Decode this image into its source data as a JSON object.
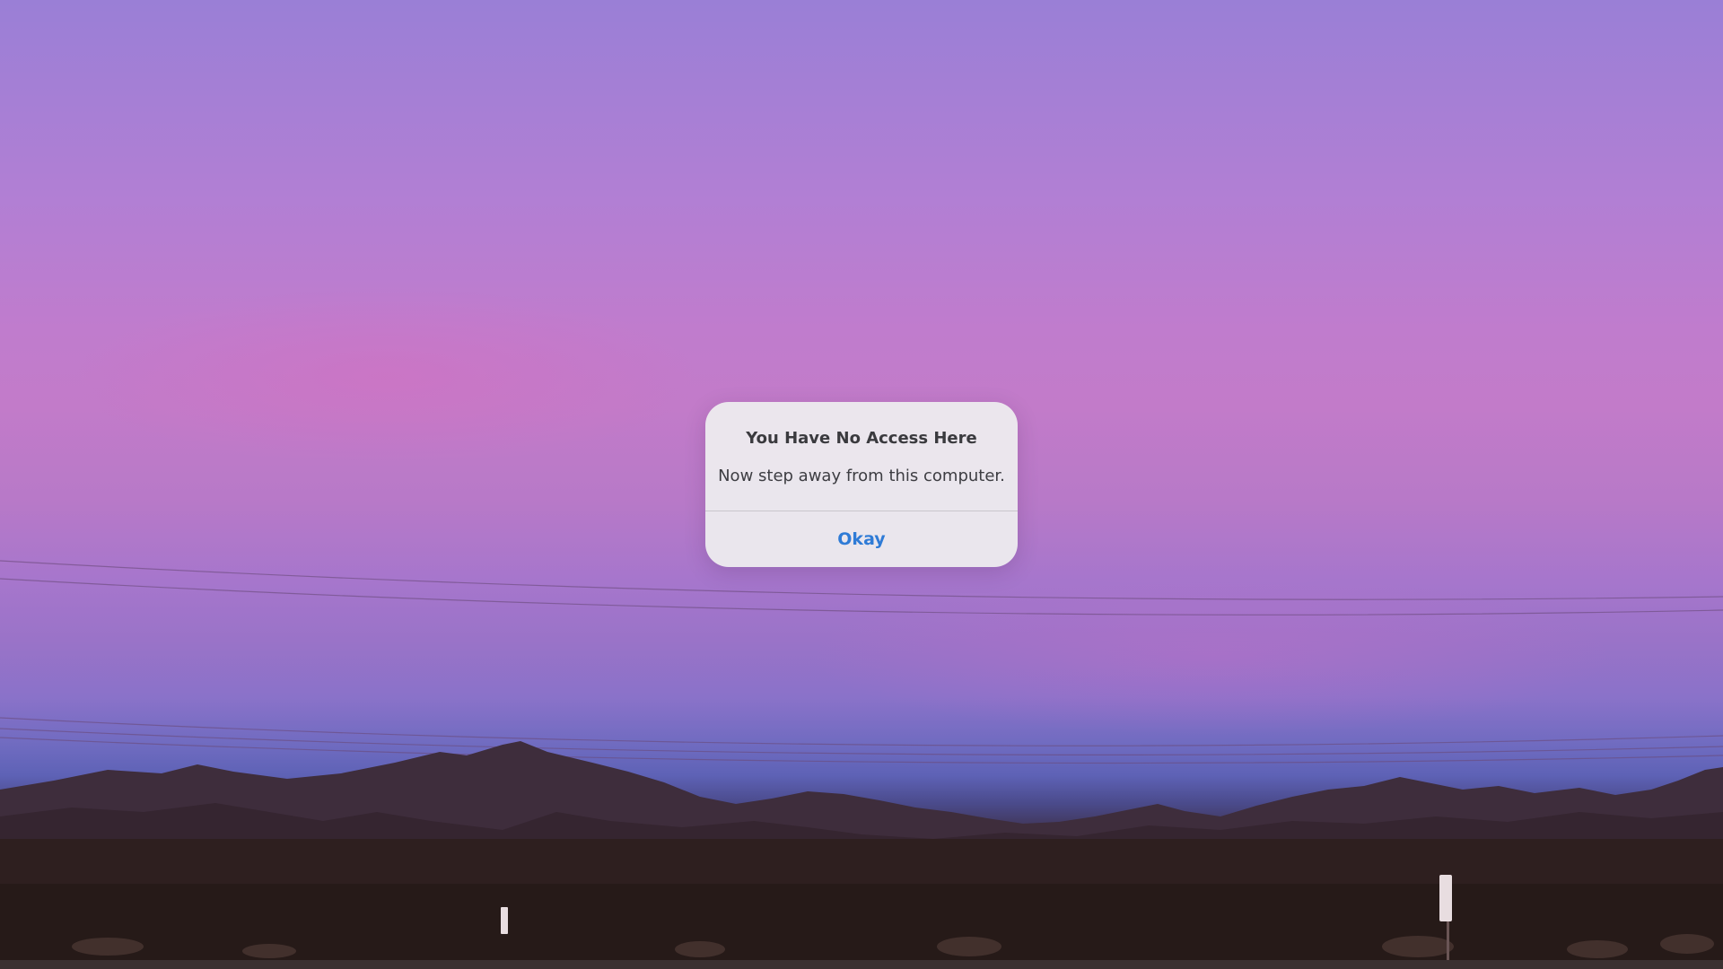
{
  "wallpaper": {
    "description_icon": "desert-sunset-wallpaper",
    "colors": {
      "sky_top": "#9a7fd6",
      "sky_mid": "#c07ccd",
      "horizon": "#5e62b6",
      "mountains": "#3b2a35",
      "ground": "#2c1d1e"
    }
  },
  "alert": {
    "title": "You Have No Access Here",
    "message": "Now step away from this computer.",
    "button_label": "Okay",
    "colors": {
      "background": "#eceaee",
      "button_text": "#2f7bd6",
      "title_text": "#3a3a3e"
    }
  }
}
